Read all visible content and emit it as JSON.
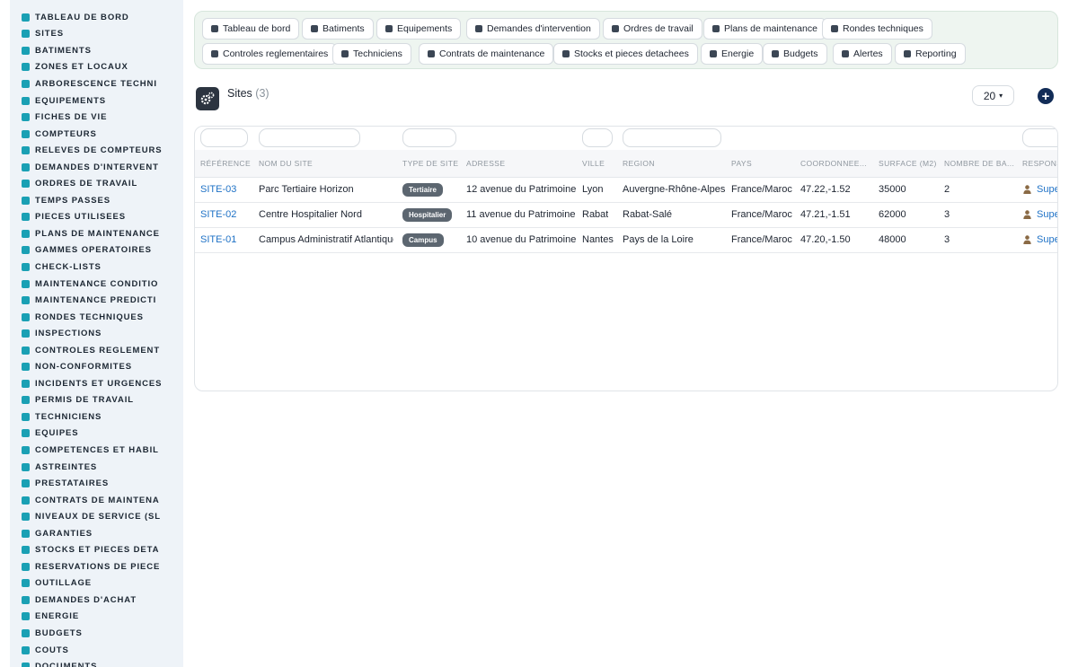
{
  "sidebar": {
    "items": [
      {
        "label": "TABLEAU DE BORD",
        "icon": "dashboard-icon"
      },
      {
        "label": "SITES",
        "icon": "map-pin-icon"
      },
      {
        "label": "BATIMENTS",
        "icon": "building-icon"
      },
      {
        "label": "ZONES ET LOCAUX",
        "icon": "grid-icon"
      },
      {
        "label": "ARBORESCENCE TECHNI",
        "icon": "sitemap-icon"
      },
      {
        "label": "EQUIPEMENTS",
        "icon": "gears-icon"
      },
      {
        "label": "FICHES DE VIE",
        "icon": "history-icon"
      },
      {
        "label": "COMPTEURS",
        "icon": "gauge-icon"
      },
      {
        "label": "RELEVES DE COMPTEURS",
        "icon": "clipboard-icon"
      },
      {
        "label": "DEMANDES D'INTERVENT",
        "icon": "question-icon"
      },
      {
        "label": "ORDRES DE TRAVAIL",
        "icon": "clipboard-check-icon"
      },
      {
        "label": "TEMPS PASSES",
        "icon": "clock-icon"
      },
      {
        "label": "PIECES UTILISEES",
        "icon": "boxes-icon"
      },
      {
        "label": "PLANS DE MAINTENANCE",
        "icon": "calendar-icon"
      },
      {
        "label": "GAMMES OPERATOIRES",
        "icon": "list-check-icon"
      },
      {
        "label": "CHECK-LISTS",
        "icon": "list-icon"
      },
      {
        "label": "MAINTENANCE CONDITIO",
        "icon": "thermometer-icon"
      },
      {
        "label": "MAINTENANCE PREDICTI",
        "icon": "chart-icon"
      },
      {
        "label": "RONDES TECHNIQUES",
        "icon": "route-icon"
      },
      {
        "label": "INSPECTIONS",
        "icon": "search-icon"
      },
      {
        "label": "CONTROLES REGLEMENT",
        "icon": "clipboard-icon"
      },
      {
        "label": "NON-CONFORMITES",
        "icon": "alert-circle-icon"
      },
      {
        "label": "INCIDENTS ET URGENCES",
        "icon": "warning-icon"
      },
      {
        "label": "PERMIS DE TRAVAIL",
        "icon": "file-signature-icon"
      },
      {
        "label": "TECHNICIENS",
        "icon": "user-helmet-icon"
      },
      {
        "label": "EQUIPES",
        "icon": "users-icon"
      },
      {
        "label": "COMPETENCES ET HABIL",
        "icon": "certificate-icon"
      },
      {
        "label": "ASTREINTES",
        "icon": "phone-icon"
      },
      {
        "label": "PRESTATAIRES",
        "icon": "handshake-icon"
      },
      {
        "label": "CONTRATS DE MAINTENA",
        "icon": "file-contract-icon"
      },
      {
        "label": "NIVEAUX DE SERVICE (SL",
        "icon": "stopwatch-icon"
      },
      {
        "label": "GARANTIES",
        "icon": "shield-icon"
      },
      {
        "label": "STOCKS ET PIECES DETA",
        "icon": "warehouse-icon"
      },
      {
        "label": "RESERVATIONS DE PIECE",
        "icon": "bookmark-icon"
      },
      {
        "label": "OUTILLAGE",
        "icon": "tools-icon"
      },
      {
        "label": "DEMANDES D'ACHAT",
        "icon": "cart-icon"
      },
      {
        "label": "ENERGIE",
        "icon": "bolt-icon"
      },
      {
        "label": "BUDGETS",
        "icon": "money-icon"
      },
      {
        "label": "COUTS",
        "icon": "coins-icon"
      },
      {
        "label": "DOCUMENTS",
        "icon": "folder-icon"
      }
    ]
  },
  "modules": [
    {
      "label": "Tableau de bord",
      "icon": "dashboard-icon"
    },
    {
      "label": "Batiments",
      "icon": "building-icon"
    },
    {
      "label": "Equipements",
      "icon": "gears-icon"
    },
    {
      "label": "Demandes d'intervention",
      "icon": "question-icon"
    },
    {
      "label": "Ordres de travail",
      "icon": "clipboard-check-icon"
    },
    {
      "label": "Plans de maintenance",
      "icon": "calendar-icon"
    },
    {
      "label": "Rondes techniques",
      "icon": "route-icon"
    },
    {
      "label": "Controles reglementaires",
      "icon": "clipboard-icon"
    },
    {
      "label": "Techniciens",
      "icon": "user-helmet-icon"
    },
    {
      "label": "Contrats de maintenance",
      "icon": "file-contract-icon"
    },
    {
      "label": "Stocks et pieces detachees",
      "icon": "warehouse-icon"
    },
    {
      "label": "Energie",
      "icon": "bolt-icon"
    },
    {
      "label": "Budgets",
      "icon": "money-icon"
    },
    {
      "label": "Alertes",
      "icon": "bell-icon"
    },
    {
      "label": "Reporting",
      "icon": "pie-chart-icon"
    }
  ],
  "header": {
    "title": "Sites",
    "count": "(3)",
    "page_size": "20",
    "add_icon": "plus-circle-icon",
    "page_icon": "gears-icon"
  },
  "table": {
    "columns": [
      "RÉFÉRENCE",
      "NOM DU SITE",
      "TYPE DE SITE",
      "ADRESSE",
      "VILLE",
      "REGION",
      "PAYS",
      "COORDONNEE...",
      "SURFACE (M2)",
      "NOMBRE DE BA...",
      "RESPONS"
    ],
    "rows": [
      {
        "ref": "SITE-03",
        "name": "Parc Tertiaire Horizon",
        "type": "Tertiaire",
        "address": "12 avenue du Patrimoine",
        "city": "Lyon",
        "region": "Auvergne-Rhône-Alpes",
        "country": "France/Maroc",
        "coords": "47.22,-1.52",
        "surface": "35000",
        "buildings": "2",
        "manager": "Supe"
      },
      {
        "ref": "SITE-02",
        "name": "Centre Hospitalier Nord",
        "type": "Hospitalier",
        "address": "11 avenue du Patrimoine",
        "city": "Rabat",
        "region": "Rabat-Salé",
        "country": "France/Maroc",
        "coords": "47.21,-1.51",
        "surface": "62000",
        "buildings": "3",
        "manager": "Supe"
      },
      {
        "ref": "SITE-01",
        "name": "Campus Administratif Atlantique",
        "type": "Campus",
        "address": "10 avenue du Patrimoine",
        "city": "Nantes",
        "region": "Pays de la Loire",
        "country": "France/Maroc",
        "coords": "47.20,-1.50",
        "surface": "48000",
        "buildings": "3",
        "manager": "Supe"
      }
    ]
  },
  "colors": {
    "sidebar_icon": "#1aa0b4",
    "link": "#1f72c6",
    "badge": "#5c6670",
    "add_button": "#122c57",
    "user_icon": "#8a6a45"
  }
}
